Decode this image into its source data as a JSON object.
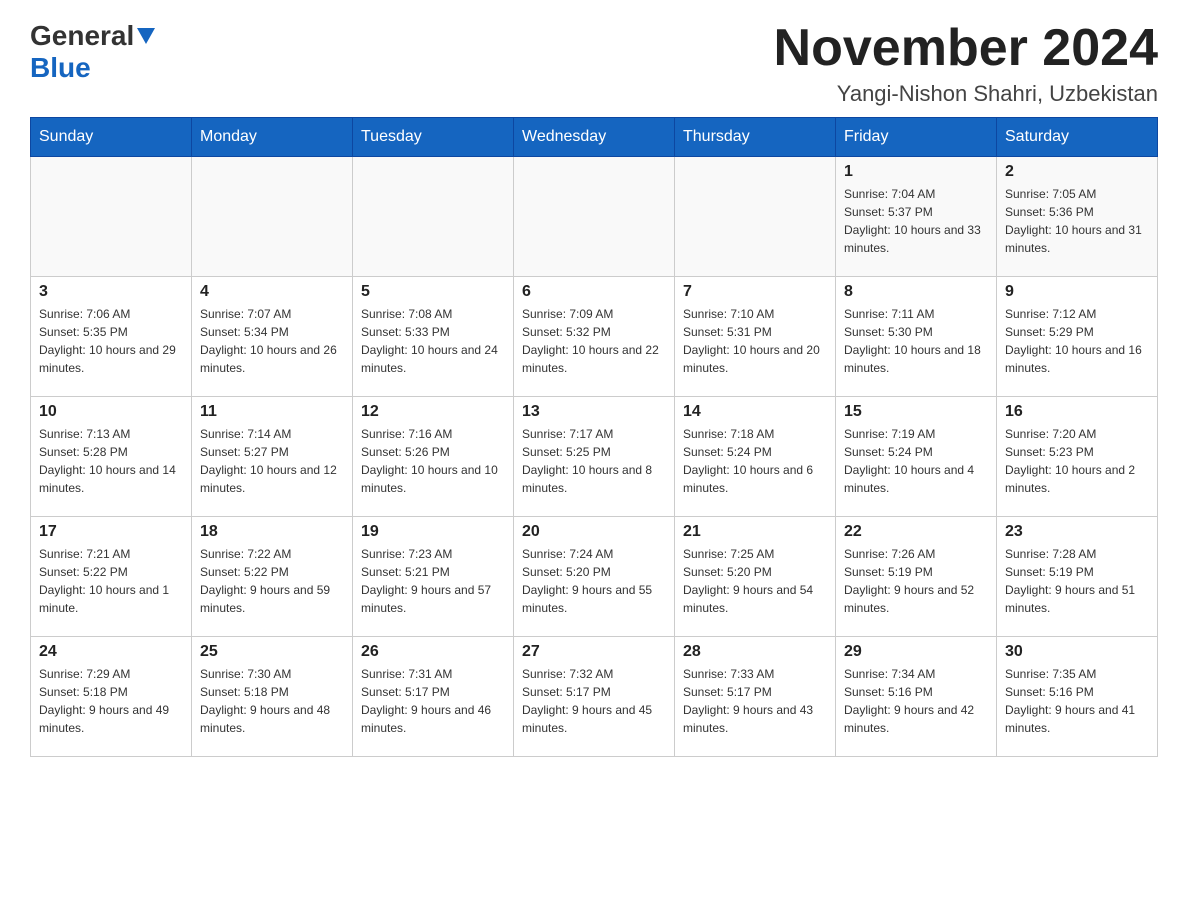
{
  "header": {
    "logo_text_general": "General",
    "logo_text_blue": "Blue",
    "month_title": "November 2024",
    "location": "Yangi-Nishon Shahri, Uzbekistan"
  },
  "days_of_week": [
    "Sunday",
    "Monday",
    "Tuesday",
    "Wednesday",
    "Thursday",
    "Friday",
    "Saturday"
  ],
  "weeks": [
    [
      {
        "day": "",
        "sunrise": "",
        "sunset": "",
        "daylight": ""
      },
      {
        "day": "",
        "sunrise": "",
        "sunset": "",
        "daylight": ""
      },
      {
        "day": "",
        "sunrise": "",
        "sunset": "",
        "daylight": ""
      },
      {
        "day": "",
        "sunrise": "",
        "sunset": "",
        "daylight": ""
      },
      {
        "day": "",
        "sunrise": "",
        "sunset": "",
        "daylight": ""
      },
      {
        "day": "1",
        "sunrise": "Sunrise: 7:04 AM",
        "sunset": "Sunset: 5:37 PM",
        "daylight": "Daylight: 10 hours and 33 minutes."
      },
      {
        "day": "2",
        "sunrise": "Sunrise: 7:05 AM",
        "sunset": "Sunset: 5:36 PM",
        "daylight": "Daylight: 10 hours and 31 minutes."
      }
    ],
    [
      {
        "day": "3",
        "sunrise": "Sunrise: 7:06 AM",
        "sunset": "Sunset: 5:35 PM",
        "daylight": "Daylight: 10 hours and 29 minutes."
      },
      {
        "day": "4",
        "sunrise": "Sunrise: 7:07 AM",
        "sunset": "Sunset: 5:34 PM",
        "daylight": "Daylight: 10 hours and 26 minutes."
      },
      {
        "day": "5",
        "sunrise": "Sunrise: 7:08 AM",
        "sunset": "Sunset: 5:33 PM",
        "daylight": "Daylight: 10 hours and 24 minutes."
      },
      {
        "day": "6",
        "sunrise": "Sunrise: 7:09 AM",
        "sunset": "Sunset: 5:32 PM",
        "daylight": "Daylight: 10 hours and 22 minutes."
      },
      {
        "day": "7",
        "sunrise": "Sunrise: 7:10 AM",
        "sunset": "Sunset: 5:31 PM",
        "daylight": "Daylight: 10 hours and 20 minutes."
      },
      {
        "day": "8",
        "sunrise": "Sunrise: 7:11 AM",
        "sunset": "Sunset: 5:30 PM",
        "daylight": "Daylight: 10 hours and 18 minutes."
      },
      {
        "day": "9",
        "sunrise": "Sunrise: 7:12 AM",
        "sunset": "Sunset: 5:29 PM",
        "daylight": "Daylight: 10 hours and 16 minutes."
      }
    ],
    [
      {
        "day": "10",
        "sunrise": "Sunrise: 7:13 AM",
        "sunset": "Sunset: 5:28 PM",
        "daylight": "Daylight: 10 hours and 14 minutes."
      },
      {
        "day": "11",
        "sunrise": "Sunrise: 7:14 AM",
        "sunset": "Sunset: 5:27 PM",
        "daylight": "Daylight: 10 hours and 12 minutes."
      },
      {
        "day": "12",
        "sunrise": "Sunrise: 7:16 AM",
        "sunset": "Sunset: 5:26 PM",
        "daylight": "Daylight: 10 hours and 10 minutes."
      },
      {
        "day": "13",
        "sunrise": "Sunrise: 7:17 AM",
        "sunset": "Sunset: 5:25 PM",
        "daylight": "Daylight: 10 hours and 8 minutes."
      },
      {
        "day": "14",
        "sunrise": "Sunrise: 7:18 AM",
        "sunset": "Sunset: 5:24 PM",
        "daylight": "Daylight: 10 hours and 6 minutes."
      },
      {
        "day": "15",
        "sunrise": "Sunrise: 7:19 AM",
        "sunset": "Sunset: 5:24 PM",
        "daylight": "Daylight: 10 hours and 4 minutes."
      },
      {
        "day": "16",
        "sunrise": "Sunrise: 7:20 AM",
        "sunset": "Sunset: 5:23 PM",
        "daylight": "Daylight: 10 hours and 2 minutes."
      }
    ],
    [
      {
        "day": "17",
        "sunrise": "Sunrise: 7:21 AM",
        "sunset": "Sunset: 5:22 PM",
        "daylight": "Daylight: 10 hours and 1 minute."
      },
      {
        "day": "18",
        "sunrise": "Sunrise: 7:22 AM",
        "sunset": "Sunset: 5:22 PM",
        "daylight": "Daylight: 9 hours and 59 minutes."
      },
      {
        "day": "19",
        "sunrise": "Sunrise: 7:23 AM",
        "sunset": "Sunset: 5:21 PM",
        "daylight": "Daylight: 9 hours and 57 minutes."
      },
      {
        "day": "20",
        "sunrise": "Sunrise: 7:24 AM",
        "sunset": "Sunset: 5:20 PM",
        "daylight": "Daylight: 9 hours and 55 minutes."
      },
      {
        "day": "21",
        "sunrise": "Sunrise: 7:25 AM",
        "sunset": "Sunset: 5:20 PM",
        "daylight": "Daylight: 9 hours and 54 minutes."
      },
      {
        "day": "22",
        "sunrise": "Sunrise: 7:26 AM",
        "sunset": "Sunset: 5:19 PM",
        "daylight": "Daylight: 9 hours and 52 minutes."
      },
      {
        "day": "23",
        "sunrise": "Sunrise: 7:28 AM",
        "sunset": "Sunset: 5:19 PM",
        "daylight": "Daylight: 9 hours and 51 minutes."
      }
    ],
    [
      {
        "day": "24",
        "sunrise": "Sunrise: 7:29 AM",
        "sunset": "Sunset: 5:18 PM",
        "daylight": "Daylight: 9 hours and 49 minutes."
      },
      {
        "day": "25",
        "sunrise": "Sunrise: 7:30 AM",
        "sunset": "Sunset: 5:18 PM",
        "daylight": "Daylight: 9 hours and 48 minutes."
      },
      {
        "day": "26",
        "sunrise": "Sunrise: 7:31 AM",
        "sunset": "Sunset: 5:17 PM",
        "daylight": "Daylight: 9 hours and 46 minutes."
      },
      {
        "day": "27",
        "sunrise": "Sunrise: 7:32 AM",
        "sunset": "Sunset: 5:17 PM",
        "daylight": "Daylight: 9 hours and 45 minutes."
      },
      {
        "day": "28",
        "sunrise": "Sunrise: 7:33 AM",
        "sunset": "Sunset: 5:17 PM",
        "daylight": "Daylight: 9 hours and 43 minutes."
      },
      {
        "day": "29",
        "sunrise": "Sunrise: 7:34 AM",
        "sunset": "Sunset: 5:16 PM",
        "daylight": "Daylight: 9 hours and 42 minutes."
      },
      {
        "day": "30",
        "sunrise": "Sunrise: 7:35 AM",
        "sunset": "Sunset: 5:16 PM",
        "daylight": "Daylight: 9 hours and 41 minutes."
      }
    ]
  ]
}
